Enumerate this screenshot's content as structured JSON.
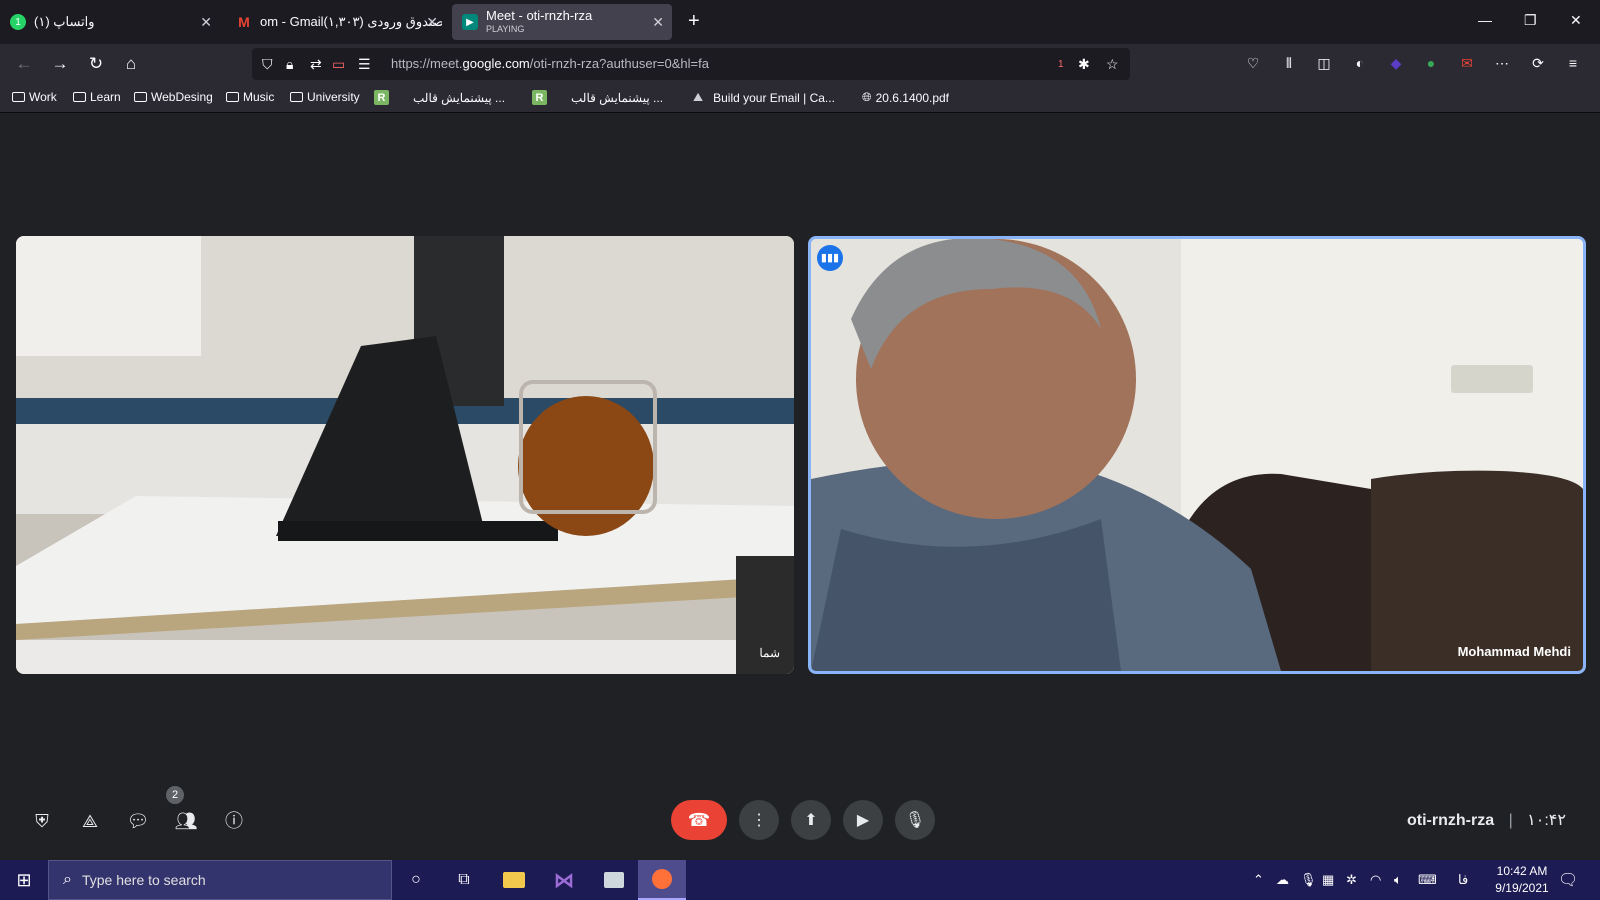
{
  "tabs": [
    {
      "label": "واتساپ (۱)",
      "sub": ""
    },
    {
      "label": "om - Gmail(۱,۳۰۳) صندوق ورودی",
      "sub": ""
    },
    {
      "label": "Meet - oti-rnzh-rza",
      "sub": "PLAYING"
    }
  ],
  "url": {
    "prefix": "https://meet.",
    "domain": "google.com",
    "rest": "/oti-rnzh-rza?authuser=0&hl=fa",
    "badge": "1"
  },
  "bookmarks": [
    "Work",
    "Learn",
    "WebDesing",
    "Music",
    "University",
    "پیشنمایش قالب ...",
    "پیشنمایش قالب ...",
    "Build your Email | Ca...",
    "20.6.1400.pdf"
  ],
  "videos": {
    "self_name": "شما",
    "remote_name": "Mohammad Mehdi"
  },
  "meeting": {
    "code": "oti-rnzh-rza",
    "time": "۱۰:۴۲",
    "participants": "2"
  },
  "taskbar": {
    "search_placeholder": "Type here to search",
    "time": "10:42 AM",
    "date": "9/19/2021",
    "lang": "فا"
  },
  "colors": {
    "hangup": "#ea4335",
    "active_speaker_border": "#8ab4f8",
    "taskbar": "#1d1b54"
  }
}
